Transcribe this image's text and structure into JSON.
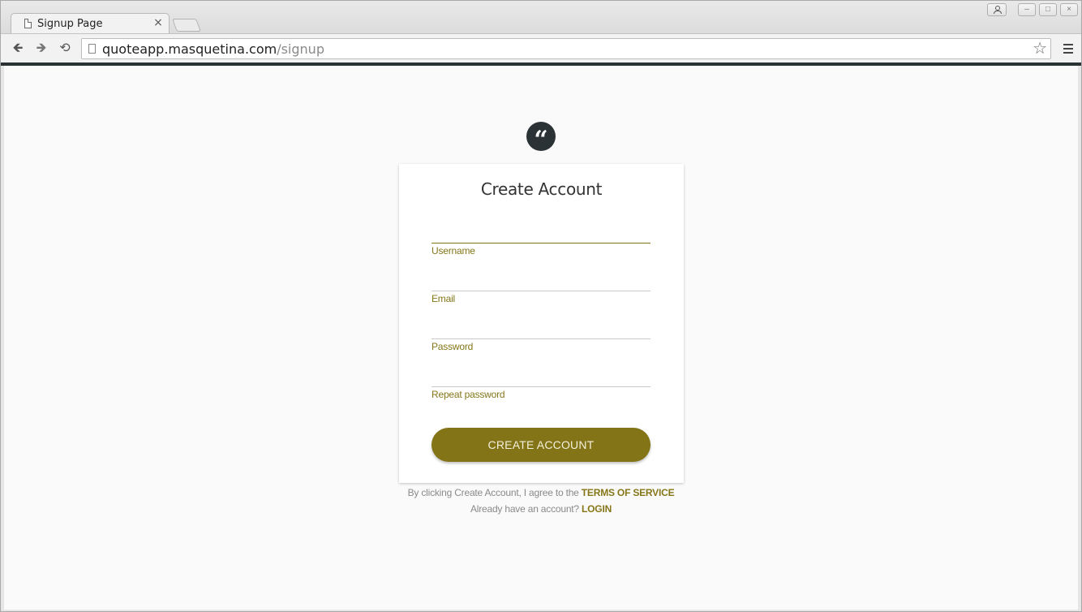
{
  "browser": {
    "tab_title": "Signup Page",
    "tab_close": "×",
    "url_host": "quoteapp.masquetina.com",
    "url_path": "/signup",
    "nav_back": "🡸",
    "nav_forward": "🡺",
    "nav_reload": "⟲",
    "star": "☆",
    "win_minimize": "–",
    "win_maximize": "□",
    "win_close": "×"
  },
  "page": {
    "logo_glyph": "“",
    "title": "Create Account",
    "fields": [
      {
        "label": "Username",
        "value": "",
        "placeholder": ""
      },
      {
        "label": "Email",
        "value": "",
        "placeholder": ""
      },
      {
        "label": "Password",
        "value": "",
        "placeholder": ""
      },
      {
        "label": "Repeat password",
        "value": "",
        "placeholder": ""
      }
    ],
    "submit_label": "CREATE ACCOUNT",
    "terms_text": "By clicking Create Account, I agree to the",
    "terms_link": "TERMS OF SERVICE",
    "login_text": "Already have an account?",
    "login_link": "LOGIN"
  },
  "colors": {
    "accent": "#837417",
    "header_bar": "#2b3236"
  }
}
